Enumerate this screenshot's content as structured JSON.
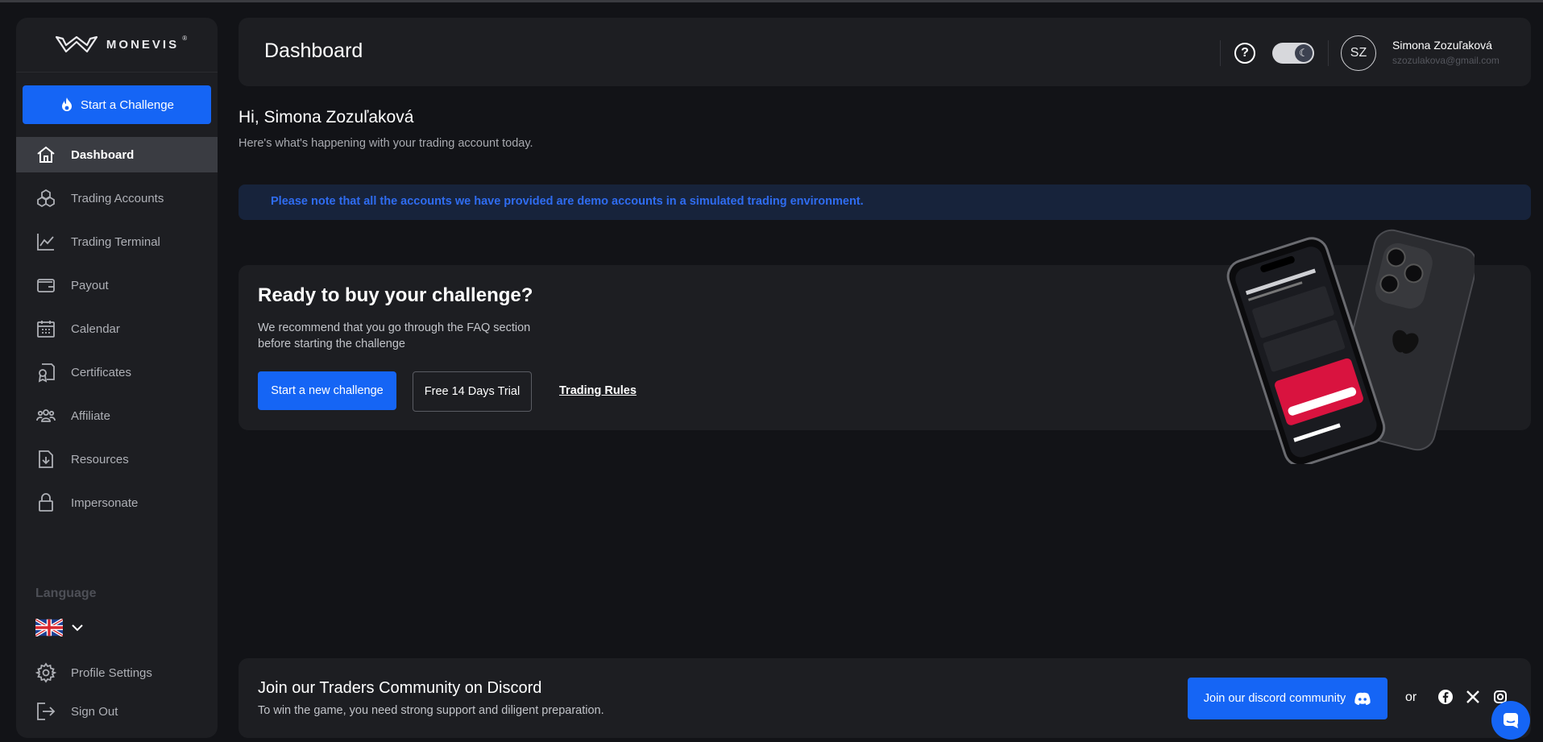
{
  "brand": {
    "name": "MONEVIS",
    "mark": "®"
  },
  "sidebar": {
    "cta": "Start a Challenge",
    "items": [
      {
        "label": "Dashboard",
        "icon": "home-icon",
        "active": true
      },
      {
        "label": "Trading Accounts",
        "icon": "cubes-icon"
      },
      {
        "label": "Trading Terminal",
        "icon": "chart-line-icon"
      },
      {
        "label": "Payout",
        "icon": "wallet-icon"
      },
      {
        "label": "Calendar",
        "icon": "calendar-icon"
      },
      {
        "label": "Certificates",
        "icon": "certificate-icon"
      },
      {
        "label": "Affiliate",
        "icon": "users-icon"
      },
      {
        "label": "Resources",
        "icon": "file-download-icon"
      },
      {
        "label": "Impersonate",
        "icon": "lock-icon"
      }
    ],
    "language_label": "Language",
    "language_flag": "uk-flag-icon",
    "profile_settings": "Profile Settings",
    "sign_out": "Sign Out"
  },
  "header": {
    "title": "Dashboard",
    "help": "?",
    "user": {
      "initials": "SZ",
      "name": "Simona Zozuľaková",
      "email": "szozulakova@gmail.com"
    }
  },
  "greeting": {
    "title": "Hi, Simona Zozuľaková",
    "subtitle": "Here's what's happening with your trading account today."
  },
  "notice": "Please note that all the accounts we have provided are demo accounts in a simulated trading environment.",
  "challenge": {
    "title": "Ready to buy your challenge?",
    "text": "We recommend that you go through the FAQ section before starting the challenge",
    "primary": "Start a new challenge",
    "secondary": "Free 14 Days Trial",
    "link": "Trading Rules"
  },
  "discord": {
    "title": "Join our Traders Community on Discord",
    "subtitle": "To win the game, you need strong support and diligent preparation.",
    "button": "Join our discord community",
    "or": "or"
  },
  "colors": {
    "accent": "#1565f5",
    "panel": "#1d1e22",
    "background": "#121317",
    "notice_text": "#2f6cf0"
  }
}
